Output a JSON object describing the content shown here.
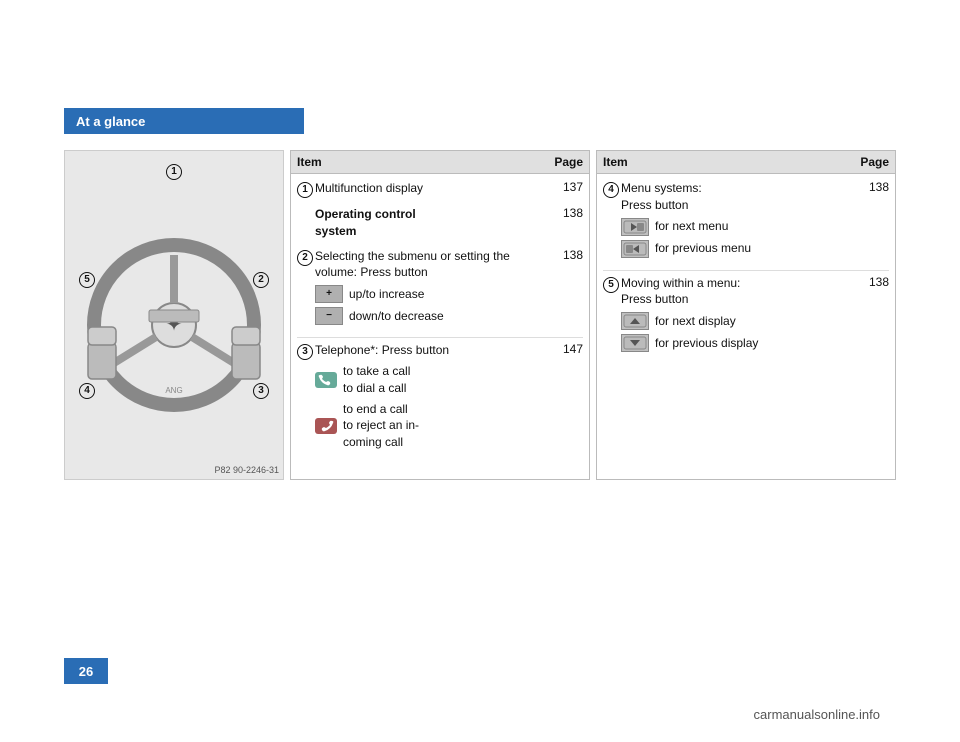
{
  "header": {
    "title": "At a glance"
  },
  "page_number": "26",
  "footer_url": "carmanualsonline.info",
  "image_caption": "P82 90-2246-31",
  "wheel_labels": [
    "1",
    "2",
    "3",
    "4",
    "5"
  ],
  "left_table": {
    "col_item": "Item",
    "col_page": "Page",
    "rows": [
      {
        "num": "1",
        "text": "Multifunction display",
        "page": "137"
      },
      {
        "num": "",
        "text_bold": "Operating control system",
        "page": "138"
      },
      {
        "num": "2",
        "text": "Selecting the submenu or setting the volume: Press button",
        "page": "138",
        "icons": [
          {
            "symbol": "+",
            "label": "up/to increase"
          },
          {
            "symbol": "−",
            "label": "down/to decrease"
          }
        ]
      },
      {
        "num": "3",
        "text": "Telephone*: Press button",
        "page": "147",
        "icons": [
          {
            "symbol": "call",
            "label": "to take a call\nto dial a call"
          },
          {
            "symbol": "end",
            "label": "to end a call\nto reject an in-\ncoming call"
          }
        ]
      }
    ]
  },
  "right_table": {
    "col_item": "Item",
    "col_page": "Page",
    "rows": [
      {
        "num": "4",
        "text": "Menu systems: Press button",
        "page": "138",
        "icons": [
          {
            "symbol": "▶",
            "label": "for next menu"
          },
          {
            "symbol": "◀",
            "label": "for previous menu"
          }
        ]
      },
      {
        "num": "5",
        "text": "Moving within a menu: Press button",
        "page": "138",
        "icons": [
          {
            "symbol": "▲",
            "label": "for next display"
          },
          {
            "symbol": "▼",
            "label": "for previous display"
          }
        ]
      }
    ]
  }
}
